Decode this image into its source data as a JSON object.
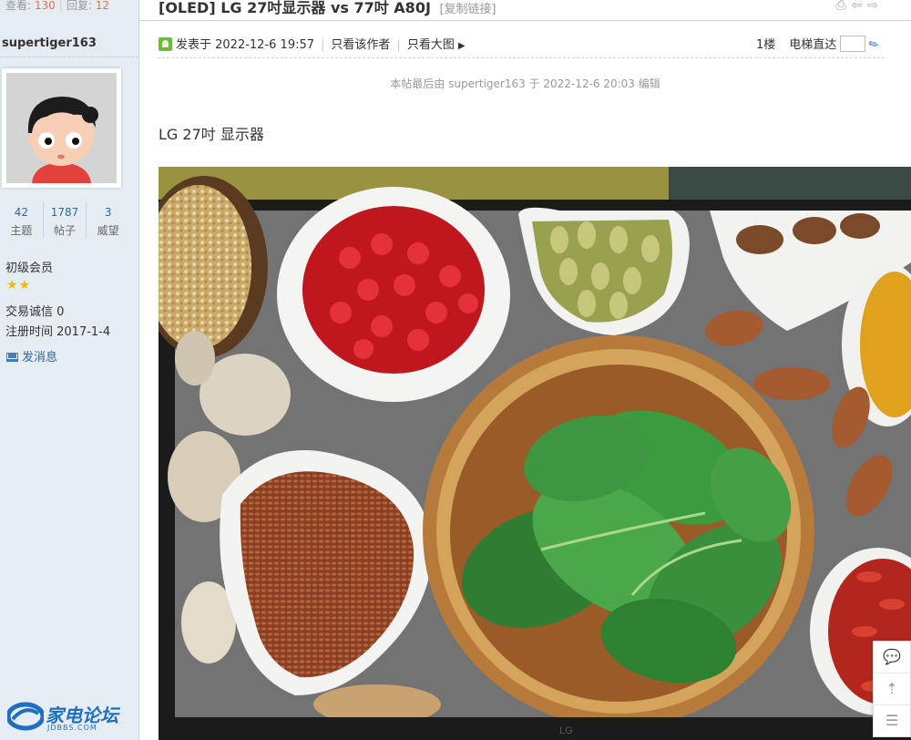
{
  "sidebar": {
    "views_label": "查看:",
    "views_count": "130",
    "replies_label": "回复:",
    "replies_count": "12",
    "author_name": "supertiger163",
    "stats": [
      {
        "value": "42",
        "label": "主题"
      },
      {
        "value": "1787",
        "label": "帖子"
      },
      {
        "value": "3",
        "label": "威望"
      }
    ],
    "rank": "初级会员",
    "stars": "★★",
    "trade_credit": "交易诚信  0",
    "register_time": "注册时间  2017-1-4",
    "send_message": "发消息",
    "logo_text": "家电论坛",
    "logo_sub": "JDBBS.COM"
  },
  "thread": {
    "title": "[OLED] LG 27吋显示器 vs 77吋 A80J",
    "copy_link": "[复制链接]",
    "posted_at": "发表于 2022-12-6 19:57",
    "only_author": "只看该作者",
    "view_large": "只看大图",
    "floor": "1楼",
    "jump_label": "电梯直达",
    "edited_note": "本帖最后由 supertiger163 于 2022-12-6 20:03 编辑",
    "body_text": "LG 27吋 显示器",
    "monitor_brand": "LG"
  },
  "icons": {
    "print": "print-icon",
    "prev": "arrow-left-icon",
    "next": "arrow-right-icon",
    "reply": "comment-icon",
    "top": "back-to-top-icon",
    "list": "list-icon"
  }
}
